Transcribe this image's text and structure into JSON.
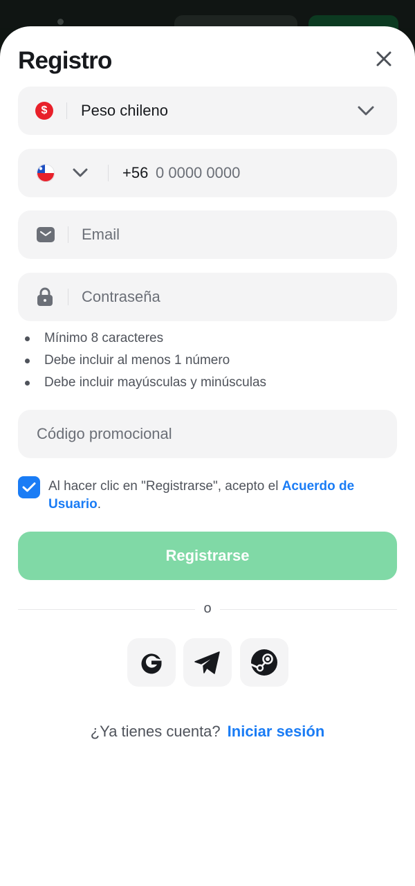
{
  "modal": {
    "title": "Registro"
  },
  "currency": {
    "symbol": "$",
    "value": "Peso chileno"
  },
  "phone": {
    "code": "+56",
    "placeholder": "0 0000 0000"
  },
  "email": {
    "placeholder": "Email"
  },
  "password": {
    "placeholder": "Contraseña"
  },
  "password_rules": [
    "Mínimo 8 caracteres",
    "Debe incluir al menos 1 número",
    "Debe incluir mayúsculas y minúsculas"
  ],
  "promo": {
    "placeholder": "Código promocional"
  },
  "terms": {
    "checked": true,
    "text": "Al hacer clic en \"Registrarse\", acepto el ",
    "link": "Acuerdo de Usuario",
    "end": "."
  },
  "submit": {
    "label": "Registrarse"
  },
  "divider": {
    "label": "o"
  },
  "social": [
    {
      "icon": "google-icon"
    },
    {
      "icon": "telegram-icon"
    },
    {
      "icon": "steam-icon"
    }
  ],
  "login": {
    "prompt": "¿Ya tienes cuenta?",
    "link": "Iniciar sesión"
  },
  "colors": {
    "accent": "#1a7cf5",
    "submit_bg": "#80d9a6",
    "field_bg": "#f4f4f5",
    "currency_badge": "#e8202a"
  }
}
